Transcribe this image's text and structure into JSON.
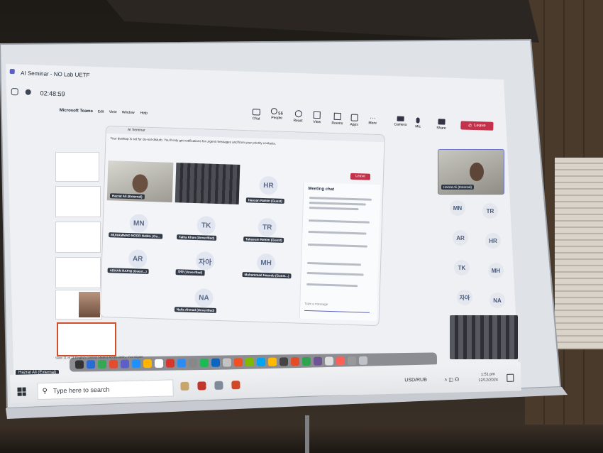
{
  "window": {
    "title": "AI Seminar - NO Lab UETF",
    "timer": "02:48:59"
  },
  "teams_toolbar": {
    "app_label": "Microsoft Teams",
    "menu": [
      "Edit",
      "View",
      "Window",
      "Help"
    ],
    "buttons": [
      "Chat",
      "People",
      "React",
      "View",
      "Rooms",
      "Apps",
      "More",
      "Camera",
      "Mic",
      "Share"
    ],
    "people_count": "56",
    "leave_label": "Leave"
  },
  "inner_window": {
    "title": "AI Seminar",
    "leave_label": "Leave",
    "notice": "Your desktop is set for do-not-disturb. You'll only get notifications for urgent messages and from your priority contacts."
  },
  "participants": [
    {
      "initials": "",
      "name": "Hazrat Ali (External)",
      "kind": "video"
    },
    {
      "initials": "",
      "name": "",
      "kind": "room-video"
    },
    {
      "initials": "HR",
      "name": "Hassan Rahim (Guest)",
      "kind": "avatar"
    },
    {
      "initials": "MN",
      "name": "MUHAMMAD NOOR NABIL (Gu...",
      "kind": "avatar"
    },
    {
      "initials": "TK",
      "name": "Talha Khan (Unverified)",
      "kind": "avatar"
    },
    {
      "initials": "TR",
      "name": "Tabasum Rehim (Guest)",
      "kind": "avatar"
    },
    {
      "initials": "AR",
      "name": "ADNAN RAFIQ (Guest...)",
      "kind": "avatar"
    },
    {
      "initials": "자아",
      "name": "자아 (Unverified)",
      "kind": "avatar"
    },
    {
      "initials": "MH",
      "name": "Muhammad Haseeb (Guest...)",
      "kind": "avatar"
    },
    {
      "initials": "NA",
      "name": "Naila Ahmad (Unverified)",
      "kind": "avatar"
    }
  ],
  "chat": {
    "title": "Meeting chat",
    "input_placeholder": "Type a message"
  },
  "side_panel": {
    "presenter_name": "Hazrat Ali (External)",
    "avatars": [
      "MN",
      "TR",
      "AR",
      "HR",
      "TK",
      "MH",
      "자아",
      "NA"
    ]
  },
  "taskbar": {
    "search_placeholder": "Type here to search",
    "currency": "USD/RUB",
    "time": "1:51 pm",
    "date": "12/12/2024",
    "tooltip": "Hazrat Ali (External)"
  },
  "status_bar": {
    "text": "Slide 11 of 11   English (United States)   Accessibility: Investigate"
  },
  "colors": {
    "screen": "#e9ecf0",
    "teams_accent": "#5b5fc7",
    "leave": "#c4314b"
  }
}
